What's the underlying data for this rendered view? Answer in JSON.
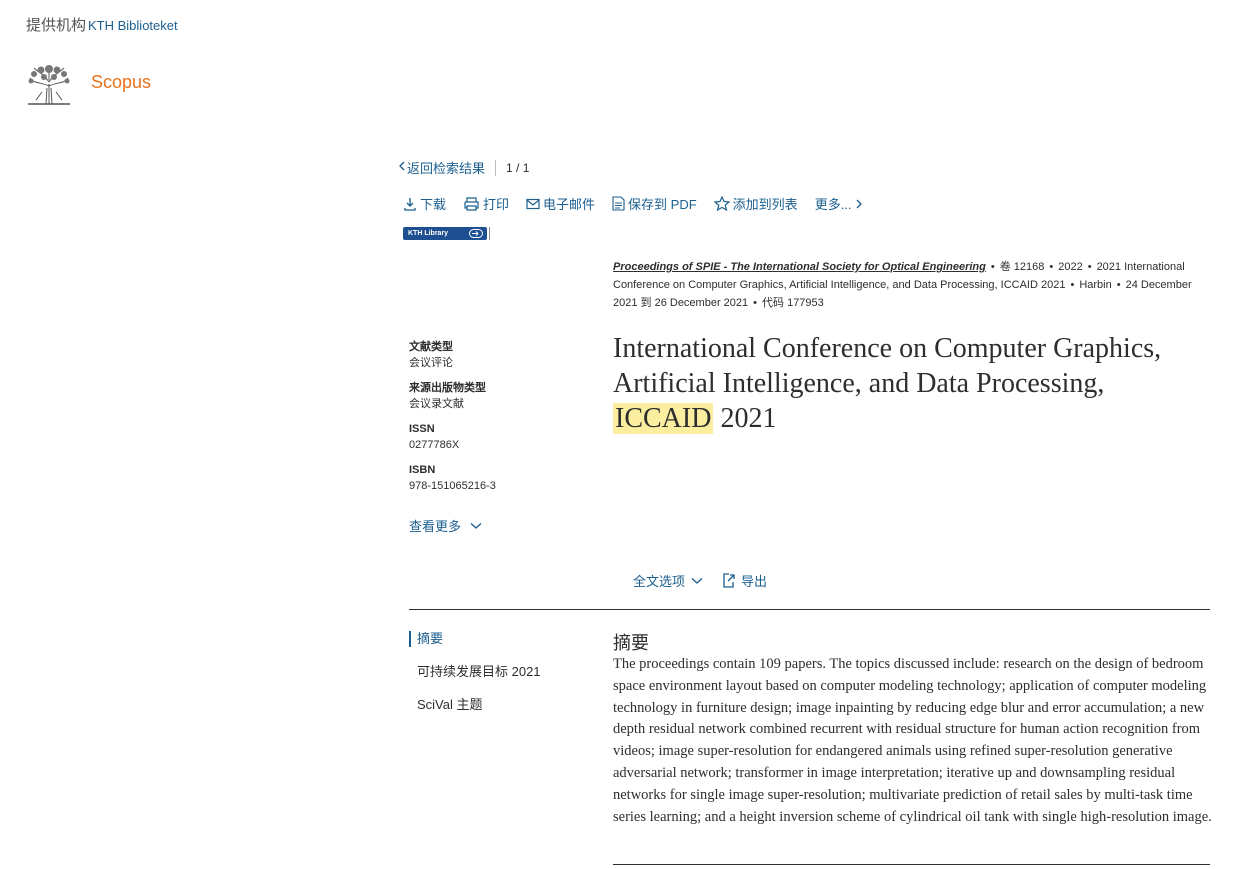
{
  "header": {
    "provider_label": "提供机构",
    "provider_name": "KTH Biblioteket",
    "brand": "Scopus"
  },
  "nav": {
    "back_label": "返回检索结果",
    "pager": "1 / 1"
  },
  "toolbar": {
    "download": "下载",
    "print": "打印",
    "email": "电子邮件",
    "save_pdf": "保存到 PDF",
    "add_list": "添加到列表",
    "more": "更多..."
  },
  "kth_badge": "KTH Library",
  "source": {
    "journal": "Proceedings of SPIE - The International Society for Optical Engineering",
    "volume": "卷 12168",
    "year": "2022",
    "conference": "2021 International Conference on Computer Graphics, Artificial Intelligence, and Data Processing, ICCAID 2021",
    "location": "Harbin",
    "dates": "24 December 2021 到 26 December 2021",
    "code": "代码 177953"
  },
  "title": {
    "before": "International Conference on Computer Graphics, Artificial Intelligence, and Data Processing,",
    "highlight": "ICCAID",
    "after": "2021"
  },
  "meta": [
    {
      "label": "文献类型",
      "value": "会议评论"
    },
    {
      "label": "来源出版物类型",
      "value": "会议录文献"
    },
    {
      "label": "ISSN",
      "value": "0277786X"
    },
    {
      "label": "ISBN",
      "value": "978-151065216-3"
    }
  ],
  "see_more": "查看更多",
  "fulltext": {
    "options": "全文选项",
    "export": "导出"
  },
  "sidenav": {
    "items": [
      "摘要",
      "可持续发展目标 2021",
      "SciVal 主题"
    ]
  },
  "abstract": {
    "heading": "摘要",
    "text": "The proceedings contain 109 papers. The topics discussed include: research on the design of bedroom space environment layout based on computer modeling technology; application of computer modeling technology in furniture design; image inpainting by reducing edge blur and error accumulation; a new depth residual network combined recurrent with residual structure for human action recognition from videos; image super-resolution for endangered animals using refined super-resolution generative adversarial network; transformer in image interpretation; iterative up and downsampling residual networks for single image super-resolution; multivariate prediction of retail sales by multi-task time series learning; and a height inversion scheme of cylindrical oil tank with single high-resolution image."
  },
  "colors": {
    "link": "#1b5f8f",
    "brand": "#e9711c",
    "highlight": "#fbee9f",
    "badge": "#1d4f91"
  }
}
